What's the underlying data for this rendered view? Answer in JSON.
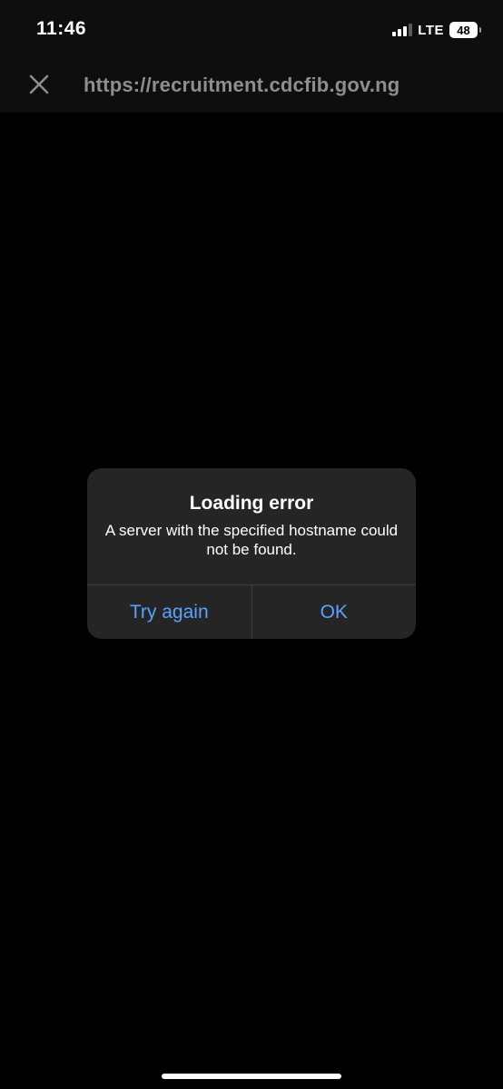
{
  "status_bar": {
    "time": "11:46",
    "network": "LTE",
    "battery": "48",
    "signal_bars_active": 3,
    "signal_bars_total": 4
  },
  "toolbar": {
    "close_icon": "close-icon",
    "url": "https://recruitment.cdcfib.gov.ng"
  },
  "alert": {
    "title": "Loading error",
    "message": "A server with the specified hostname could not be found.",
    "buttons": {
      "secondary": "Try again",
      "primary": "OK"
    },
    "accent_color": "#5aa2ff"
  }
}
